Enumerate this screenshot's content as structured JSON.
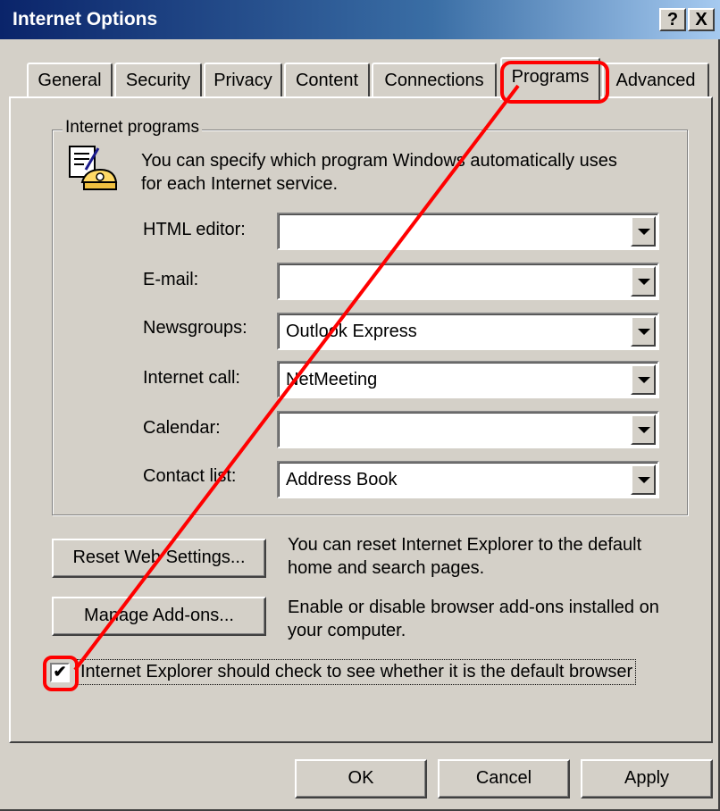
{
  "window": {
    "title": "Internet Options",
    "help_label": "?",
    "close_label": "X"
  },
  "tabs": [
    {
      "label": "General"
    },
    {
      "label": "Security"
    },
    {
      "label": "Privacy"
    },
    {
      "label": "Content"
    },
    {
      "label": "Connections"
    },
    {
      "label": "Programs",
      "active": true
    },
    {
      "label": "Advanced"
    }
  ],
  "programs": {
    "group_label": "Internet programs",
    "description_line1": "You can specify which program Windows automatically uses",
    "description_line2": "for each Internet service.",
    "icon": "programs-phone-icon",
    "fields": [
      {
        "label": "HTML editor:",
        "value": ""
      },
      {
        "label": "E-mail:",
        "value": ""
      },
      {
        "label": "Newsgroups:",
        "value": "Outlook Express"
      },
      {
        "label": "Internet call:",
        "value": "NetMeeting"
      },
      {
        "label": "Calendar:",
        "value": ""
      },
      {
        "label": "Contact list:",
        "value": "Address Book"
      }
    ]
  },
  "reset": {
    "button_label": "Reset Web Settings...",
    "description_line1": "You can reset Internet Explorer to the default",
    "description_line2": "home and search pages."
  },
  "addons": {
    "button_label": "Manage Add-ons...",
    "description_line1": "Enable or disable browser add-ons installed on",
    "description_line2": "your computer."
  },
  "default_check": {
    "checked": true,
    "mark": "✔",
    "label": "Internet Explorer should check to see whether it is the default browser"
  },
  "footer": {
    "ok_label": "OK",
    "cancel_label": "Cancel",
    "apply_label": "Apply"
  },
  "annotation": {
    "color": "#ff0000"
  }
}
